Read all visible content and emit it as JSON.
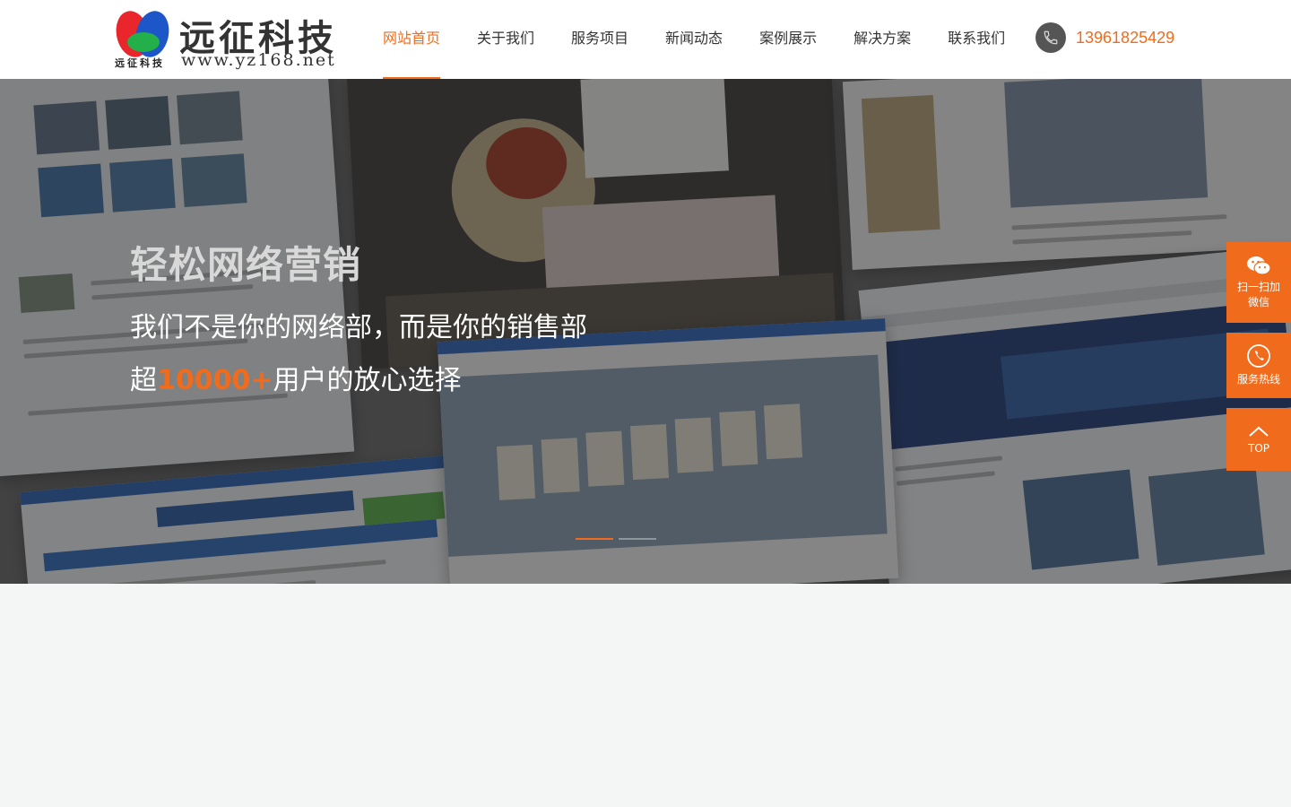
{
  "logo": {
    "title": "远征科技",
    "url": "www.yz168.net",
    "sub": "远征科技"
  },
  "nav": {
    "items": [
      {
        "label": "网站首页",
        "active": true
      },
      {
        "label": "关于我们"
      },
      {
        "label": "服务项目"
      },
      {
        "label": "新闻动态"
      },
      {
        "label": "案例展示"
      },
      {
        "label": "解决方案"
      },
      {
        "label": "联系我们"
      }
    ]
  },
  "contact": {
    "phone": "13961825429",
    "icon": "phone-icon"
  },
  "banner": {
    "line1": "轻松网络营销",
    "line2": "我们不是你的网络部，而是你的销售部",
    "line3_prefix": "超",
    "line3_highlight": "10000+",
    "line3_suffix": "用户的放心选择",
    "slides_total": 2,
    "slide_active": 1
  },
  "side_float": {
    "wechat_label1": "扫一扫加",
    "wechat_label2": "微信",
    "hotline_label": "服务热线",
    "top_label": "TOP"
  },
  "colors": {
    "accent": "#f06c1c",
    "nav_text": "#333333",
    "page_bg": "#f4f5f5"
  }
}
